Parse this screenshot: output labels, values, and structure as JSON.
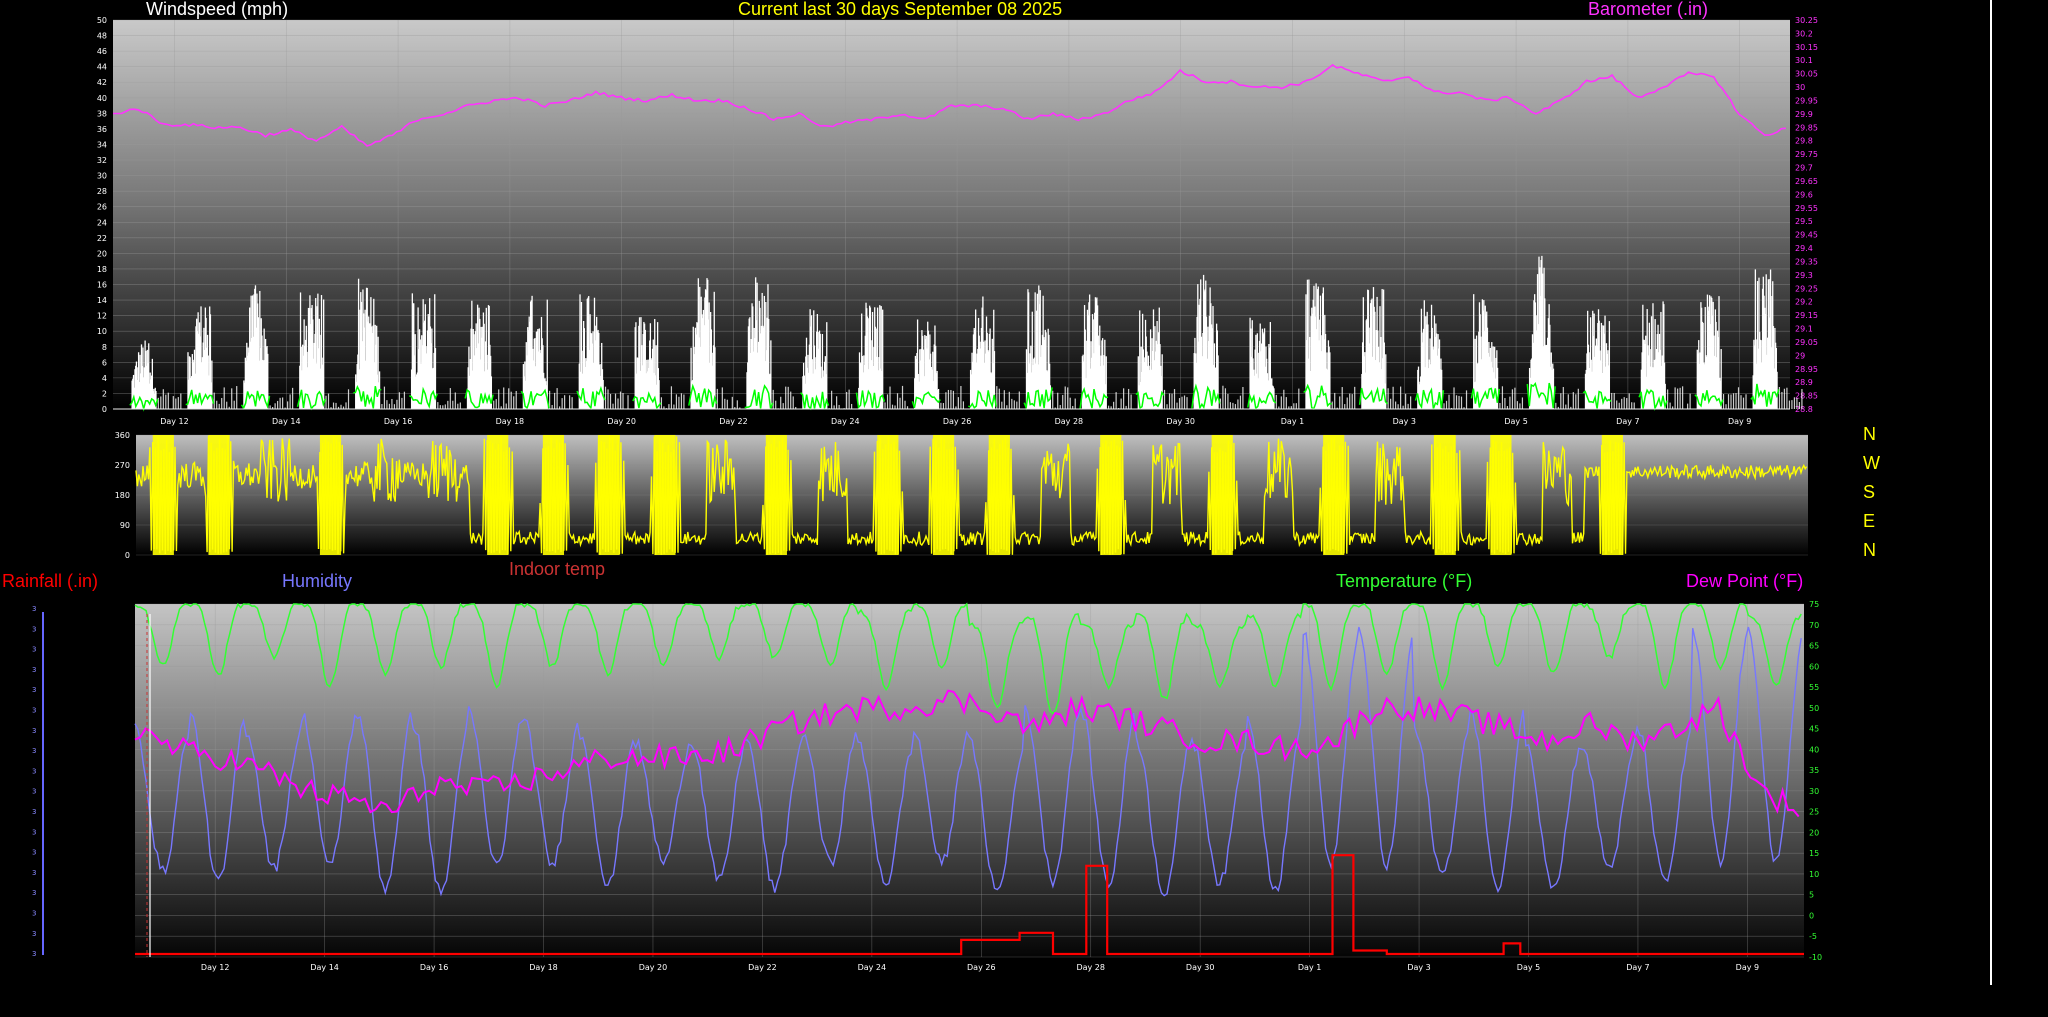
{
  "header": {
    "windspeed_title": "Windspeed (mph)",
    "main_title": "Current last 30 days September 08 2025",
    "barometer_title": "Barometer (.in)"
  },
  "bottom_labels": {
    "rainfall": "Rainfall (.in)",
    "humidity": "Humidity",
    "indoor_temp": "Indoor temp",
    "temperature": "Temperature (°F)",
    "dew_point": "Dew Point (°F)"
  },
  "compass_labels": [
    "N",
    "W",
    "S",
    "E",
    "N"
  ],
  "colors": {
    "windspeed_title": "#ffffff",
    "main_title": "#ffff00",
    "barometer": "#ff33ff",
    "wind_bars": "#ffffff",
    "wind_gust": "#00ff00",
    "direction": "#ffff00",
    "rainfall": "#ff0000",
    "humidity": "#7777ff",
    "indoor_temp": "#cc3333",
    "temperature": "#33ff33",
    "dew_point": "#ff00ff",
    "compass": "#ffff00"
  },
  "chart_data": [
    {
      "type": "bar",
      "name": "wind_barometer",
      "x_tick_labels": [
        "Day 12",
        "Day 14",
        "Day 16",
        "Day 18",
        "Day 20",
        "Day 22",
        "Day 24",
        "Day 26",
        "Day 28",
        "Day 30",
        "Day 1",
        "Day 3",
        "Day 5",
        "Day 7",
        "Day 9"
      ],
      "x_range_days": [
        0,
        30
      ],
      "left_axis": {
        "ylim": [
          0,
          50
        ],
        "tick_labels": [
          "0",
          "2",
          "4",
          "6",
          "8",
          "10",
          "12",
          "14",
          "16",
          "18",
          "20",
          "22",
          "24",
          "26",
          "28",
          "30",
          "32",
          "34",
          "36",
          "38",
          "40",
          "42",
          "44",
          "46",
          "48",
          "50"
        ]
      },
      "right_axis": {
        "ylim": [
          28.8,
          30.25
        ],
        "tick_labels": [
          "28.8",
          "28.85",
          "28.9",
          "28.95",
          "29",
          "29.05",
          "29.1",
          "29.15",
          "29.2",
          "29.25",
          "29.3",
          "29.35",
          "29.4",
          "29.45",
          "29.5",
          "29.55",
          "29.6",
          "29.65",
          "29.7",
          "29.75",
          "29.8",
          "29.85",
          "29.9",
          "29.95",
          "30",
          "30.05",
          "30.1",
          "30.15",
          "30.2",
          "30.25"
        ]
      },
      "daily_max_wind_mph": [
        9,
        14,
        16,
        15,
        17,
        15,
        14,
        15,
        16,
        12,
        17,
        18,
        13,
        14,
        12,
        15,
        16,
        15,
        14,
        18,
        12,
        17,
        16,
        14,
        15,
        20,
        13,
        14,
        15,
        18
      ],
      "barometer_in": [
        [
          0,
          29.9
        ],
        [
          0.5,
          29.92
        ],
        [
          1,
          29.86
        ],
        [
          1.5,
          29.86
        ],
        [
          2,
          29.85
        ],
        [
          2.5,
          29.85
        ],
        [
          3,
          29.82
        ],
        [
          3.5,
          29.84
        ],
        [
          4,
          29.8
        ],
        [
          4.5,
          29.85
        ],
        [
          5,
          29.78
        ],
        [
          5.5,
          29.82
        ],
        [
          6,
          29.88
        ],
        [
          6.5,
          29.9
        ],
        [
          7,
          29.93
        ],
        [
          7.5,
          29.95
        ],
        [
          8,
          29.96
        ],
        [
          8.5,
          29.93
        ],
        [
          9,
          29.95
        ],
        [
          9.5,
          29.98
        ],
        [
          10,
          29.96
        ],
        [
          10.5,
          29.95
        ],
        [
          11,
          29.97
        ],
        [
          11.5,
          29.95
        ],
        [
          12,
          29.95
        ],
        [
          12.5,
          29.92
        ],
        [
          13,
          29.88
        ],
        [
          13.5,
          29.9
        ],
        [
          14,
          29.85
        ],
        [
          14.5,
          29.87
        ],
        [
          15,
          29.88
        ],
        [
          15.5,
          29.9
        ],
        [
          16,
          29.88
        ],
        [
          16.5,
          29.93
        ],
        [
          17,
          29.93
        ],
        [
          17.5,
          29.92
        ],
        [
          18,
          29.88
        ],
        [
          18.5,
          29.9
        ],
        [
          19,
          29.88
        ],
        [
          19.5,
          29.9
        ],
        [
          20,
          29.95
        ],
        [
          20.5,
          29.98
        ],
        [
          21,
          30.06
        ],
        [
          21.5,
          30.02
        ],
        [
          22,
          30.02
        ],
        [
          22.5,
          30.0
        ],
        [
          23,
          30.0
        ],
        [
          23.5,
          30.02
        ],
        [
          24,
          30.08
        ],
        [
          24.5,
          30.05
        ],
        [
          25,
          30.02
        ],
        [
          25.5,
          30.04
        ],
        [
          26,
          29.98
        ],
        [
          26.5,
          29.98
        ],
        [
          27,
          29.95
        ],
        [
          27.5,
          29.96
        ],
        [
          28,
          29.9
        ],
        [
          28.5,
          29.95
        ],
        [
          29,
          30.02
        ],
        [
          29.5,
          30.04
        ],
        [
          30,
          29.96
        ],
        [
          30.5,
          30.0
        ],
        [
          31,
          30.05
        ],
        [
          31.5,
          30.04
        ],
        [
          32,
          29.9
        ],
        [
          32.5,
          29.82
        ],
        [
          33,
          29.85
        ]
      ]
    },
    {
      "type": "line",
      "name": "wind_direction",
      "ylim": [
        0,
        360
      ],
      "tick_labels": [
        "0",
        "90",
        "180",
        "270",
        "360"
      ],
      "daily_pattern": "dense yellow oscillation between 0 and 360 degrees most days, calm periods near 30-60 degrees, wind settling near 250 degrees late in the period"
    },
    {
      "type": "line",
      "name": "temperature_humidity_dew_rain",
      "x_tick_labels": [
        "Day 12",
        "Day 14",
        "Day 16",
        "Day 18",
        "Day 20",
        "Day 22",
        "Day 24",
        "Day 26",
        "Day 28",
        "Day 30",
        "Day 1",
        "Day 3",
        "Day 5",
        "Day 7",
        "Day 9"
      ],
      "right_axis": {
        "ylim": [
          -10,
          75
        ],
        "tick_labels": [
          "-10",
          "-5",
          "0",
          "5",
          "10",
          "15",
          "20",
          "25",
          "30",
          "35",
          "40",
          "45",
          "50",
          "55",
          "60",
          "65",
          "70",
          "75"
        ]
      },
      "temperature_daily_f": [
        [
          75,
          60
        ],
        [
          75,
          58
        ],
        [
          75,
          62
        ],
        [
          75,
          55
        ],
        [
          75,
          58
        ],
        [
          75,
          60
        ],
        [
          75,
          55
        ],
        [
          75,
          60
        ],
        [
          75,
          58
        ],
        [
          75,
          60
        ],
        [
          75,
          62
        ],
        [
          75,
          62
        ],
        [
          75,
          60
        ],
        [
          73,
          55
        ],
        [
          75,
          60
        ],
        [
          70,
          50
        ],
        [
          72,
          48
        ],
        [
          70,
          55
        ],
        [
          72,
          52
        ],
        [
          70,
          55
        ],
        [
          72,
          55
        ],
        [
          75,
          55
        ],
        [
          75,
          58
        ],
        [
          75,
          55
        ],
        [
          75,
          60
        ],
        [
          75,
          58
        ],
        [
          75,
          62
        ],
        [
          75,
          55
        ],
        [
          75,
          60
        ],
        [
          72,
          55
        ]
      ],
      "dew_point_f": [
        [
          0,
          45
        ],
        [
          1,
          40
        ],
        [
          2,
          38
        ],
        [
          3,
          35
        ],
        [
          4,
          30
        ],
        [
          5,
          28
        ],
        [
          6,
          25
        ],
        [
          7,
          32
        ],
        [
          8,
          30
        ],
        [
          9,
          32
        ],
        [
          10,
          35
        ],
        [
          11,
          38
        ],
        [
          12,
          38
        ],
        [
          13,
          38
        ],
        [
          14,
          40
        ],
        [
          15,
          45
        ],
        [
          16,
          48
        ],
        [
          17,
          50
        ],
        [
          18,
          50
        ],
        [
          19,
          52
        ],
        [
          20,
          50
        ],
        [
          21,
          45
        ],
        [
          22,
          50
        ],
        [
          23,
          48
        ],
        [
          24,
          45
        ],
        [
          25,
          42
        ],
        [
          26,
          42
        ],
        [
          27,
          40
        ],
        [
          28,
          42
        ],
        [
          29,
          50
        ],
        [
          30,
          50
        ],
        [
          31,
          48
        ],
        [
          32,
          45
        ],
        [
          33,
          42
        ],
        [
          34,
          46
        ],
        [
          35,
          42
        ],
        [
          36,
          45
        ],
        [
          37,
          50
        ],
        [
          38,
          30
        ],
        [
          39,
          25
        ]
      ],
      "humidity_daily_range": "oscillates daily between roughly 5 and 45 on the right scale, peaking near 70 around Day 27 and Day 3",
      "rainfall_in": [
        [
          0,
          0
        ],
        [
          19.8,
          0
        ],
        [
          19.8,
          0.04
        ],
        [
          21.2,
          0.04
        ],
        [
          21.2,
          0.06
        ],
        [
          22,
          0.06
        ],
        [
          22,
          0
        ],
        [
          22.8,
          0
        ],
        [
          22.8,
          0.25
        ],
        [
          23.3,
          0.25
        ],
        [
          23.3,
          0
        ],
        [
          28.7,
          0
        ],
        [
          28.7,
          0.28
        ],
        [
          29.2,
          0.28
        ],
        [
          29.2,
          0.01
        ],
        [
          30,
          0.01
        ],
        [
          30,
          0
        ],
        [
          32.8,
          0
        ],
        [
          32.8,
          0.03
        ],
        [
          33.2,
          0.03
        ],
        [
          33.2,
          0
        ],
        [
          40,
          0
        ]
      ]
    }
  ]
}
